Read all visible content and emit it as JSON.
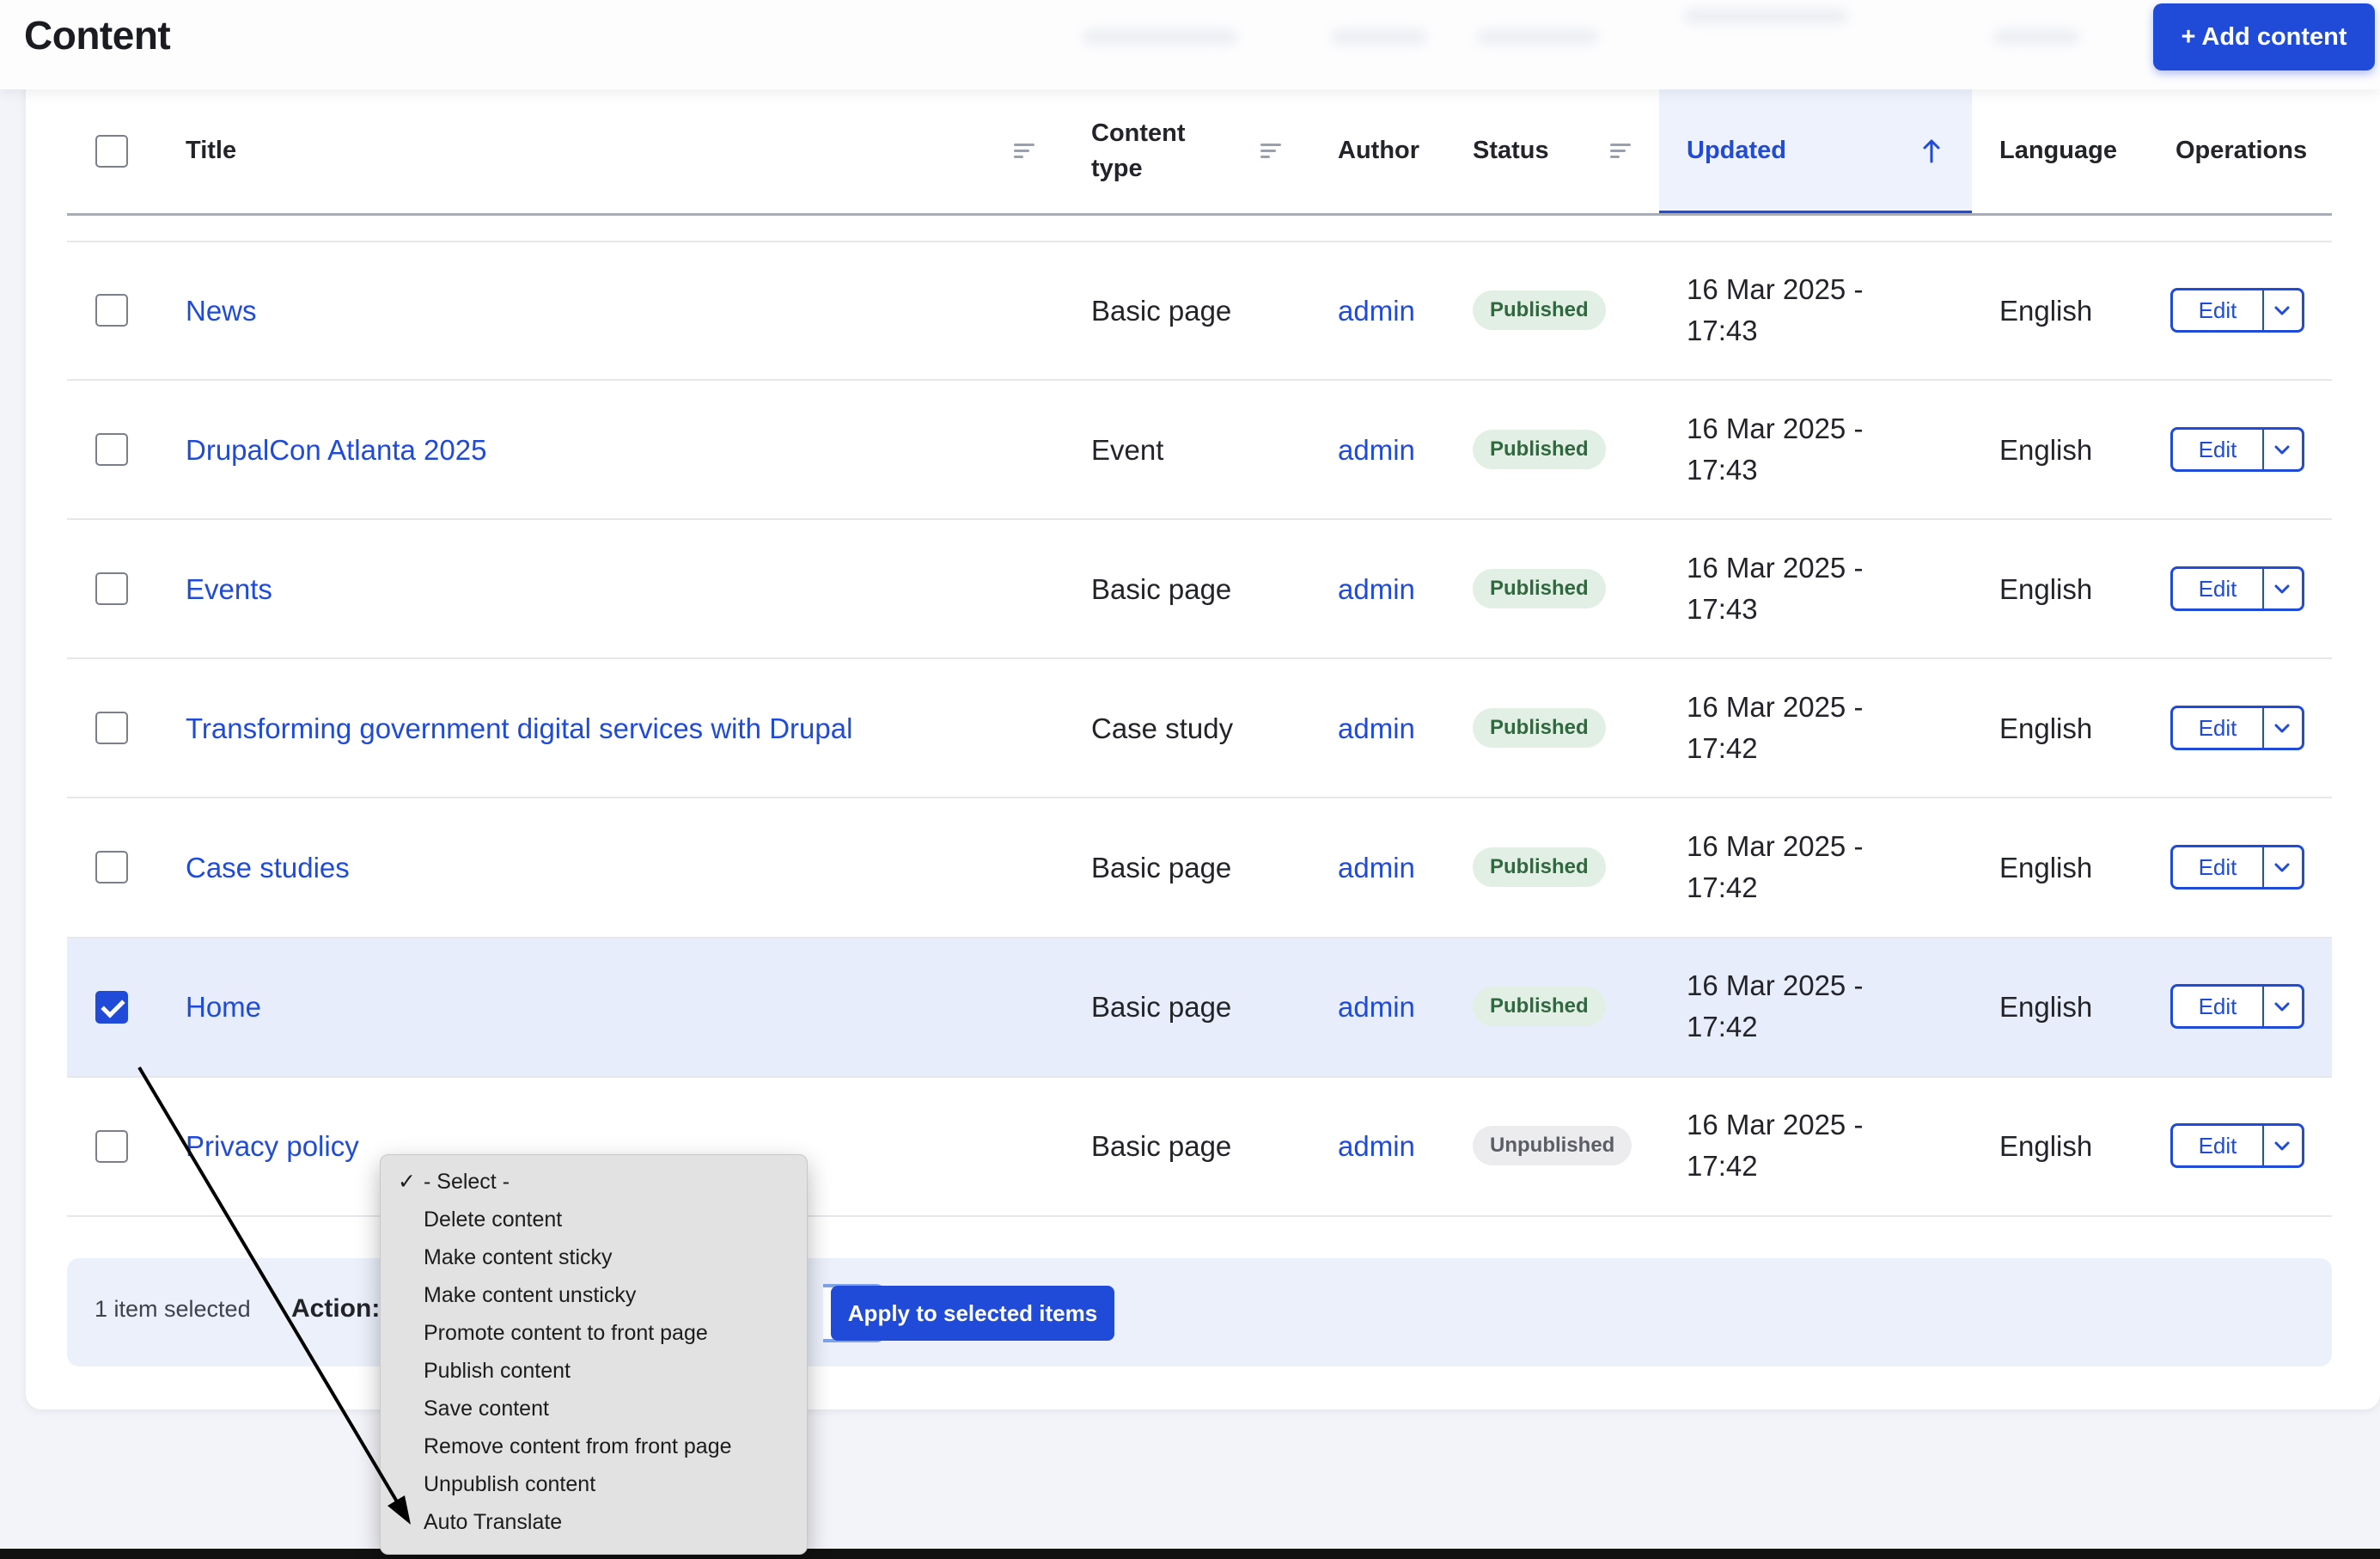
{
  "header": {
    "title": "Content",
    "add_button": "+ Add content"
  },
  "table": {
    "columns": {
      "title": "Title",
      "content_type_line1": "Content",
      "content_type_line2": "type",
      "author": "Author",
      "status": "Status",
      "updated": "Updated",
      "language": "Language",
      "operations": "Operations"
    },
    "sort": {
      "column": "Updated",
      "direction": "ascending"
    },
    "rows": [
      {
        "title": "News",
        "type": "Basic page",
        "author": "admin",
        "status": "Published",
        "date_line1": "16 Mar 2025 -",
        "date_line2": "17:43",
        "language": "English",
        "edit": "Edit",
        "checked": false
      },
      {
        "title": "DrupalCon Atlanta 2025",
        "type": "Event",
        "author": "admin",
        "status": "Published",
        "date_line1": "16 Mar 2025 -",
        "date_line2": "17:43",
        "language": "English",
        "edit": "Edit",
        "checked": false
      },
      {
        "title": "Events",
        "type": "Basic page",
        "author": "admin",
        "status": "Published",
        "date_line1": "16 Mar 2025 -",
        "date_line2": "17:43",
        "language": "English",
        "edit": "Edit",
        "checked": false
      },
      {
        "title": "Transforming government digital services with Drupal",
        "type": "Case study",
        "author": "admin",
        "status": "Published",
        "date_line1": "16 Mar 2025 -",
        "date_line2": "17:42",
        "language": "English",
        "edit": "Edit",
        "checked": false
      },
      {
        "title": "Case studies",
        "type": "Basic page",
        "author": "admin",
        "status": "Published",
        "date_line1": "16 Mar 2025 -",
        "date_line2": "17:42",
        "language": "English",
        "edit": "Edit",
        "checked": false
      },
      {
        "title": "Home",
        "type": "Basic page",
        "author": "admin",
        "status": "Published",
        "date_line1": "16 Mar 2025 -",
        "date_line2": "17:42",
        "language": "English",
        "edit": "Edit",
        "checked": true
      },
      {
        "title": "Privacy policy",
        "type": "Basic page",
        "author": "admin",
        "status": "Unpublished",
        "date_line1": "16 Mar 2025 -",
        "date_line2": "17:42",
        "language": "English",
        "edit": "Edit",
        "checked": false
      }
    ]
  },
  "bulk": {
    "selected_count": "1 item selected",
    "action_label": "Action:",
    "apply_button": "Apply to selected items"
  },
  "action_dropdown": {
    "selected_marker": "✓",
    "options": [
      "- Select -",
      "Delete content",
      "Make content sticky",
      "Make content unsticky",
      "Promote content to front page",
      "Publish content",
      "Save content",
      "Remove content from front page",
      "Unpublish content",
      "Auto Translate"
    ],
    "selected": "- Select -"
  },
  "colors": {
    "accent": "#1f4bd8",
    "published_bg": "#e2efe5",
    "published_text": "#32683f",
    "selected_row_bg": "#e7edfb"
  },
  "icons": {
    "sort": "filter-lines-icon",
    "sort_active": "arrow-up-icon",
    "edit_dropdown": "chevron-down-icon",
    "annotation": "annotation-arrow"
  }
}
